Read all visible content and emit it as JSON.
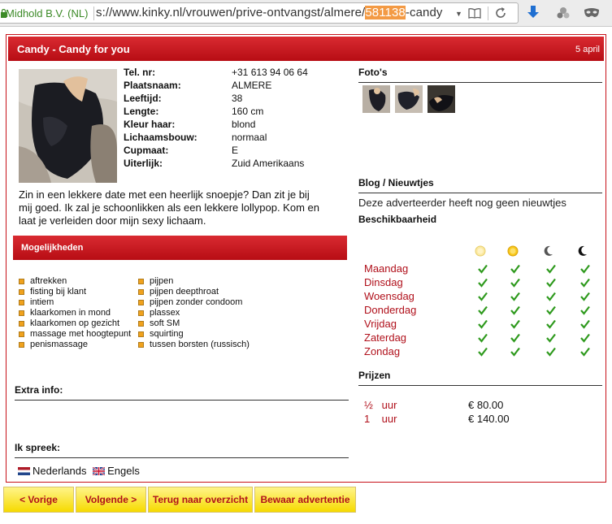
{
  "browser": {
    "site_identity": "Midhold B.V. (NL)",
    "url_prefix": "s://www.kinky.nl/vrouwen/prive-ontvangst/almere/",
    "url_highlight": "581138",
    "url_suffix": "-candy"
  },
  "ad": {
    "title": "Candy - Candy for you",
    "date": "5 april",
    "details": [
      {
        "label": "Tel. nr:",
        "value": "+31 613 94 06 64"
      },
      {
        "label": "Plaatsnaam:",
        "value": "ALMERE"
      },
      {
        "label": "Leeftijd:",
        "value": "38"
      },
      {
        "label": "Lengte:",
        "value": "160 cm"
      },
      {
        "label": "Kleur haar:",
        "value": "blond"
      },
      {
        "label": "Lichaamsbouw:",
        "value": "normaal"
      },
      {
        "label": "Cupmaat:",
        "value": "E"
      },
      {
        "label": "Uiterlijk:",
        "value": "Zuid Amerikaans"
      }
    ],
    "description": "Zin in een lekkere date met een heerlijk snoepje? Dan zit je bij mij goed. Ik zal je schoonlikken als een lekkere lollypop. Kom en laat je verleiden door mijn sexy lichaam.",
    "options_heading": "Mogelijkheden",
    "options_left": [
      "aftrekken",
      "fisting bij klant",
      "intiem",
      "klaarkomen in mond",
      "klaarkomen op gezicht",
      "massage met hoogtepunt",
      "penismassage"
    ],
    "options_right": [
      "pijpen",
      "pijpen deepthroat",
      "pijpen zonder condoom",
      "plassex",
      "soft SM",
      "squirting",
      "tussen borsten (russisch)"
    ],
    "extra_info_heading": "Extra info:",
    "languages_heading": "Ik spreek:",
    "languages": [
      "Nederlands",
      "Engels"
    ]
  },
  "right": {
    "photos_heading": "Foto's",
    "blog_heading": "Blog / Nieuwtjes",
    "blog_text": "Deze adverteerder heeft nog geen nieuwtjes",
    "availability_heading": "Beschikbaarheid",
    "time_icons": [
      "morning-sun-icon",
      "afternoon-sun-icon",
      "evening-moon-icon",
      "night-moon-icon"
    ],
    "days": [
      "Maandag",
      "Dinsdag",
      "Woensdag",
      "Donderdag",
      "Vrijdag",
      "Zaterdag",
      "Zondag"
    ],
    "prices_heading": "Prijzen",
    "prices": [
      {
        "label": "½   uur",
        "value": "€ 80.00"
      },
      {
        "label": "1    uur",
        "value": "€ 140.00"
      }
    ]
  },
  "nav": {
    "prev": "< Vorige",
    "next": "Volgende >",
    "back": "Terug naar overzicht",
    "save": "Bewaar advertentie"
  },
  "colors": {
    "brand_red": "#c8121a",
    "button_yellow": "#f6da00",
    "check_green": "#2f9a1e"
  }
}
